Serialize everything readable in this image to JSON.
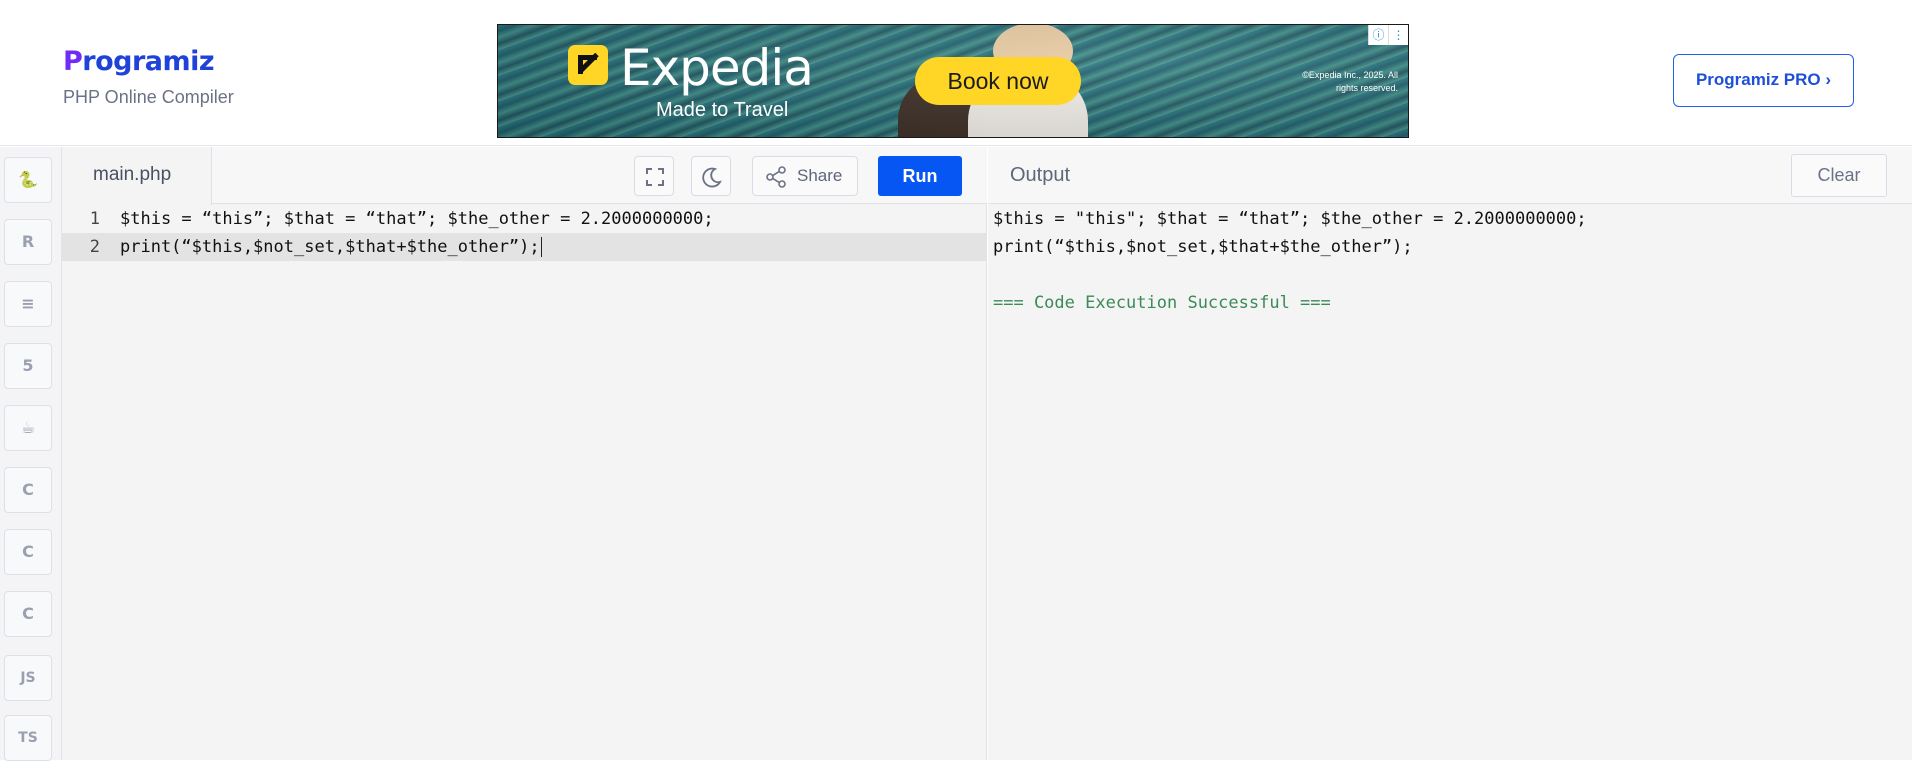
{
  "brand": {
    "name_first": "P",
    "name_rest": "rogramiz",
    "subtitle": "PHP Online Compiler"
  },
  "ad": {
    "brand": "Expedia",
    "tagline": "Made to Travel",
    "cta": "Book now",
    "legal": "©Expedia Inc., 2025. All rights reserved.",
    "info_icon": "ⓘ",
    "menu_icon": "⋮"
  },
  "header": {
    "pro_button": "Programiz PRO ›"
  },
  "sidebar": {
    "items": [
      {
        "name": "python-icon",
        "glyph": "🐍"
      },
      {
        "name": "r-icon",
        "glyph": "R"
      },
      {
        "name": "sql-icon",
        "glyph": "≡"
      },
      {
        "name": "html5-icon",
        "glyph": "5"
      },
      {
        "name": "java-icon",
        "glyph": "☕"
      },
      {
        "name": "c-icon",
        "glyph": "C"
      },
      {
        "name": "cpp-icon",
        "glyph": "C"
      },
      {
        "name": "csharp-icon",
        "glyph": "C"
      },
      {
        "name": "js-icon",
        "glyph": "JS"
      },
      {
        "name": "ts-icon",
        "glyph": "TS"
      }
    ]
  },
  "editor": {
    "file_tab": "main.php",
    "share_label": "Share",
    "run_label": "Run",
    "lines": [
      {
        "num": "1",
        "text": "$this = “this”; $that = “that”; $the_other = 2.2000000000;"
      },
      {
        "num": "2",
        "text": "print(“$this,$not_set,$that+$the_other”);"
      }
    ]
  },
  "output": {
    "title": "Output",
    "clear_label": "Clear",
    "lines": [
      "$this = \"this\"; $that = “that”; $the_other = 2.2000000000;",
      "print(“$this,$not_set,$that+$the_other”);",
      "",
      "=== Code Execution Successful ==="
    ]
  },
  "colors": {
    "accent": "#0556f3",
    "success": "#3b8a57",
    "brand": "#1f42d8"
  }
}
